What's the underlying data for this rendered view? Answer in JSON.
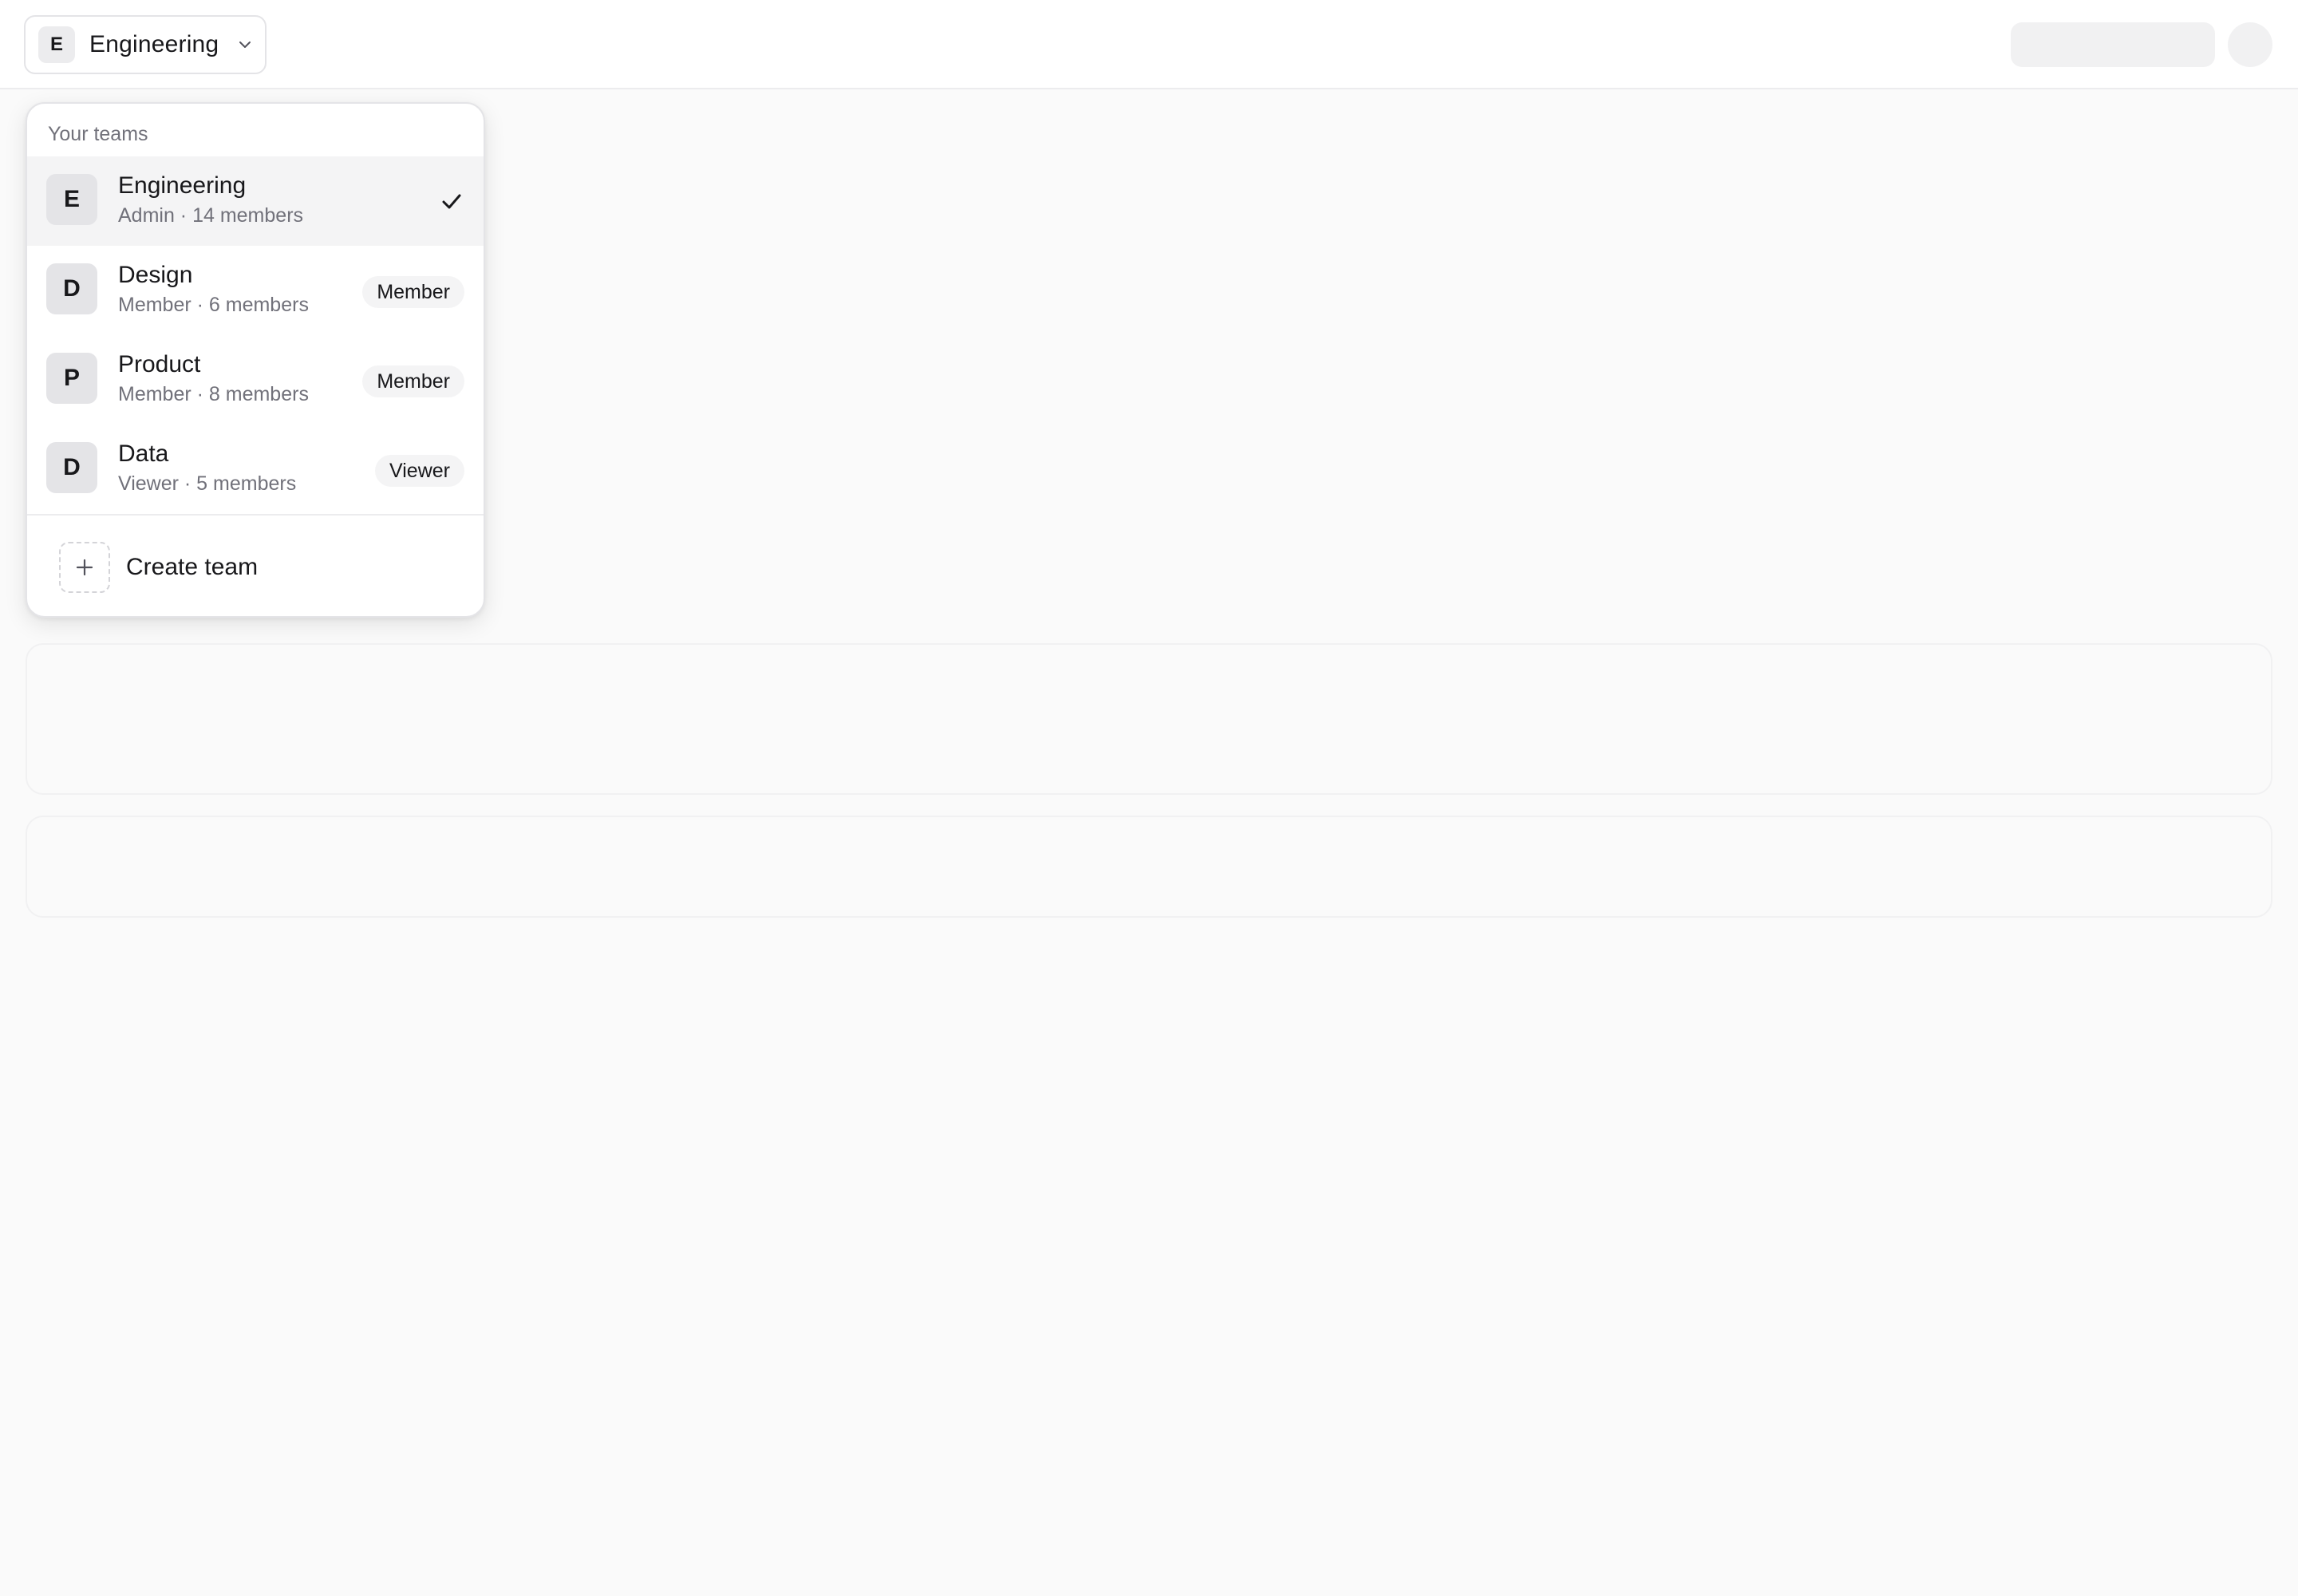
{
  "topbar": {
    "current_team": {
      "initial": "E",
      "name": "Engineering"
    }
  },
  "dropdown": {
    "header": "Your teams",
    "teams": [
      {
        "initial": "E",
        "name": "Engineering",
        "meta": "Admin · 14 members",
        "selected": true
      },
      {
        "initial": "D",
        "name": "Design",
        "meta": "Member · 6 members",
        "badge": "Member"
      },
      {
        "initial": "P",
        "name": "Product",
        "meta": "Member · 8 members",
        "badge": "Member"
      },
      {
        "initial": "D",
        "name": "Data",
        "meta": "Viewer · 5 members",
        "badge": "Viewer"
      }
    ],
    "create_label": "Create team"
  },
  "icons": {
    "chevron": "chevron-down-icon",
    "check": "check-icon",
    "plus": "plus-icon"
  }
}
